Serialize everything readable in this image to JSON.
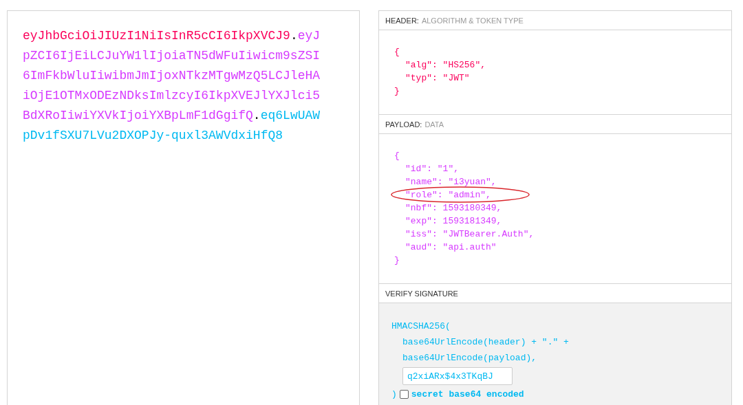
{
  "encoded": {
    "separator": ".",
    "segments": [
      {
        "text": "eyJhbGciOiJIUzI1NiIsInR5cCI6IkpXVCJ9",
        "color": "#fb015b"
      },
      {
        "text": "eyJpZCI6IjEiLCJuYW1lIjoiaTN5dWFuIiwicm9sZSI6ImFkbWluIiwibmJmIjoxNTkzMTgwMzQ5LCJleHAiOjE1OTMxODEzNDksImlzcyI6IkpXVEJlYXJlci5BdXRoIiwiYXVkIjoiYXBpLmF1dGgifQ",
        "color": "#d63aff"
      },
      {
        "text": "eq6LwUAWpDv1fSXU7LVu2DXOPJy-quxl3AWVdxiHfQ8",
        "color": "#00b9f1"
      }
    ]
  },
  "decoded": [
    {
      "kind": "json",
      "title": "HEADER:",
      "subtitle": "ALGORITHM & TOKEN TYPE",
      "color": "#fb015b",
      "open": "{",
      "close": "}",
      "fields": [
        {
          "text": "\"alg\": \"HS256\",",
          "circled": false
        },
        {
          "text": "\"typ\": \"JWT\"",
          "circled": false
        }
      ]
    },
    {
      "kind": "json",
      "title": "PAYLOAD:",
      "subtitle": "DATA",
      "color": "#d63aff",
      "open": "{",
      "close": "}",
      "fields": [
        {
          "text": "\"id\": \"1\",",
          "circled": false
        },
        {
          "text": "\"name\": \"i3yuan\",",
          "circled": false
        },
        {
          "text": "\"role\": \"admin\",",
          "circled": true
        },
        {
          "text": "\"nbf\": 1593180349,",
          "circled": false
        },
        {
          "text": "\"exp\": 1593181349,",
          "circled": false
        },
        {
          "text": "\"iss\": \"JWTBearer.Auth\",",
          "circled": false
        },
        {
          "text": "\"aud\": \"api.auth\"",
          "circled": false
        }
      ]
    },
    {
      "kind": "signature",
      "title": "VERIFY SIGNATURE",
      "color": "#00b9f1",
      "opening": "HMACSHA256(",
      "args": [
        "base64UrlEncode(header) + \".\" +",
        "base64UrlEncode(payload),"
      ],
      "secret": {
        "value": "q2xiARx$4x3TKqBJ"
      },
      "closing": ")",
      "base64": {
        "label": "secret base64 encoded",
        "checked": false
      }
    }
  ]
}
